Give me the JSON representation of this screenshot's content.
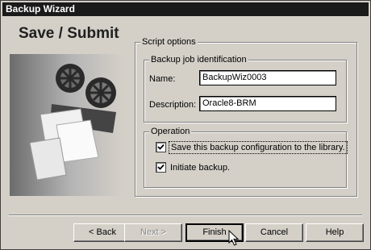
{
  "window": {
    "title": "Backup Wizard"
  },
  "page": {
    "heading": "Save / Submit"
  },
  "script_options": {
    "legend": "Script options",
    "job_id": {
      "legend": "Backup job identification",
      "name_label": "Name:",
      "name_value": "BackupWiz0003",
      "description_label": "Description:",
      "description_value": "Oracle8-BRM"
    },
    "operation": {
      "legend": "Operation",
      "save_config_label": "Save this backup configuration to the library.",
      "save_config_checked": true,
      "initiate_label": "Initiate backup.",
      "initiate_checked": true
    }
  },
  "buttons": {
    "back": "< Back",
    "next": "Next >",
    "finish": "Finish",
    "cancel": "Cancel",
    "help": "Help"
  },
  "icons": {
    "artwork": "gears-documents-illustration",
    "cursor": "pointer-cursor-icon",
    "check": "check-icon"
  }
}
